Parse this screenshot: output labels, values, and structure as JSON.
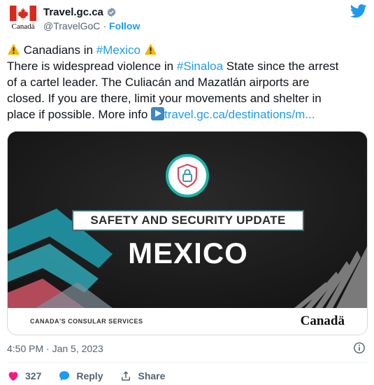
{
  "account": {
    "name": "Travel.gc.ca",
    "handle": "@TravelGoC",
    "separator": "·",
    "follow_label": "Follow",
    "logo_wordmark": "Canadä"
  },
  "tweet": {
    "line1_prefix": "Canadians in ",
    "line1_hashtag": "#Mexico",
    "line2_prefix": "There is widespread violence in ",
    "line2_hashtag": "#Sinaloa",
    "line2_suffix": " State since the arrest",
    "line3": "of a cartel leader. The Culiacán and Mazatlán airports are",
    "line4": "closed. If you are there, limit your movements and shelter in",
    "line5_prefix": "place if possible. More info ",
    "line5_link": "travel.gc.ca/destinations/m..."
  },
  "card": {
    "banner": "SAFETY AND SECURITY UPDATE",
    "country": "MEXICO",
    "footer_left": "CANADA'S CONSULAR SERVICES",
    "footer_right": "Canadä"
  },
  "meta": {
    "timestamp": "4:50 PM · Jan 5, 2023"
  },
  "actions": {
    "likes": "327",
    "reply_label": "Reply",
    "share_label": "Share"
  },
  "colors": {
    "accent": "#1d9bf0",
    "like": "#f91880",
    "teal": "#19b3a8",
    "canada_red": "#d52b1e"
  }
}
